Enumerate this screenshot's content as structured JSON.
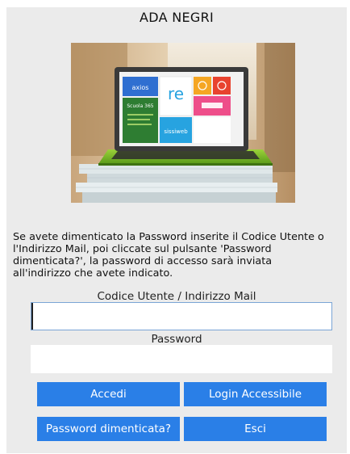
{
  "header": {
    "school_name": "ADA NEGRI"
  },
  "hero": {
    "tiles": {
      "axios": "axios",
      "re": "re",
      "scuola": "Scuola 365",
      "sissiweb": "sissiweb"
    },
    "colors": {
      "blue": "#2f6fd1",
      "green": "#54b848",
      "orange": "#f5a623",
      "red": "#e8432f",
      "pink": "#ee4e8a",
      "cyan": "#27a3e0",
      "dark_green": "#2e7d32"
    }
  },
  "help": {
    "lines": [
      "Se avete dimenticato la Password inserite il Codice Utente o",
      "l'Indirizzo Mail, poi cliccate sul pulsante 'Password",
      "dimenticata?', la password di accesso sarà inviata",
      "all'indirizzo che avete indicato."
    ]
  },
  "form": {
    "user_label": "Codice Utente / Indirizzo Mail",
    "user_value": "",
    "password_label": "Password",
    "password_value": ""
  },
  "buttons": {
    "login": "Accedi",
    "accessible_login": "Login Accessibile",
    "forgot_password": "Password dimenticata?",
    "exit": "Esci"
  },
  "theme": {
    "button_color": "#2a7fe7",
    "panel_color": "#ebebeb"
  }
}
